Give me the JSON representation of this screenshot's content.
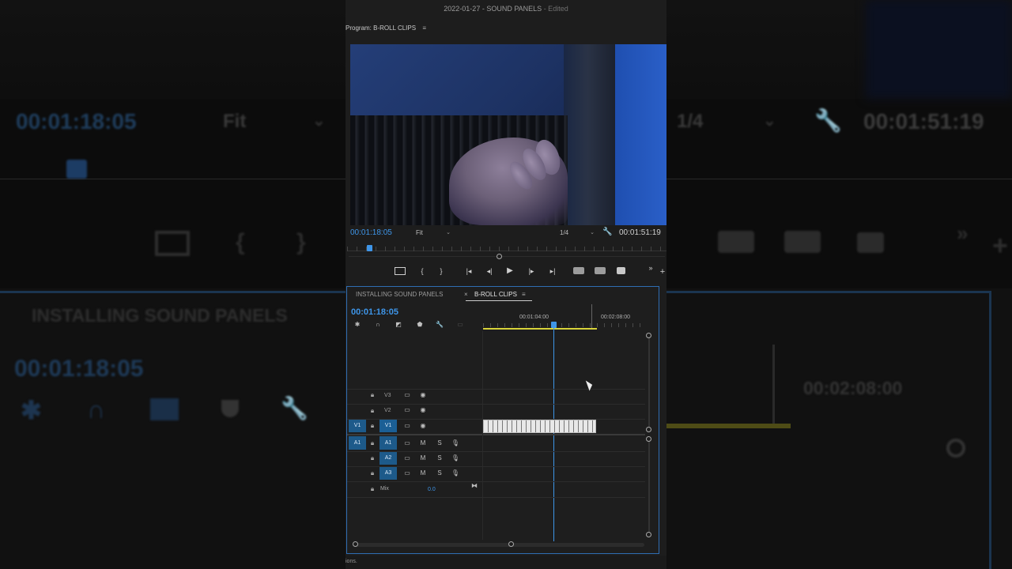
{
  "background": {
    "timecode_left": "00:01:18:05",
    "fit_label": "Fit",
    "ratio_label": "1/4",
    "timecode_right": "00:01:51:19",
    "sequence_name": "INSTALLING SOUND PANELS",
    "timecode_lower": "00:01:18:05",
    "ruler_label": "00:02:08:00"
  },
  "window": {
    "title": "2022-01-27 - SOUND PANELS",
    "status": "- Edited"
  },
  "program_monitor": {
    "header_label": "Program: B-ROLL CLIPS",
    "current_timecode": "00:01:18:05",
    "zoom_label": "Fit",
    "resolution_label": "1/4",
    "duration_timecode": "00:01:51:19"
  },
  "transport": {
    "more_label": "»",
    "add_label": "+"
  },
  "timeline": {
    "tabs": [
      {
        "label": "INSTALLING SOUND PANELS",
        "active": false
      },
      {
        "label": "B-ROLL CLIPS",
        "active": true
      }
    ],
    "close_glyph": "×",
    "current_timecode": "00:01:18:05",
    "ruler_labels": [
      "00:01:04:00",
      "00:02:08:00"
    ],
    "video_tracks": [
      {
        "source": "",
        "name": "V3"
      },
      {
        "source": "",
        "name": "V2"
      },
      {
        "source": "V1",
        "name": "V1"
      }
    ],
    "audio_tracks": [
      {
        "source": "A1",
        "name": "A1",
        "mute": "M",
        "solo": "S"
      },
      {
        "source": "",
        "name": "A2",
        "mute": "M",
        "solo": "S"
      },
      {
        "source": "",
        "name": "A3",
        "mute": "M",
        "solo": "S"
      }
    ],
    "mix_label": "Mix",
    "mix_value": "0.0"
  },
  "statusbar": {
    "text": "ions."
  },
  "colors": {
    "accent": "#3e95e8",
    "panel_border": "#2f6db3",
    "work_area": "#d7d23a",
    "track_target": "#1d5a8a"
  }
}
